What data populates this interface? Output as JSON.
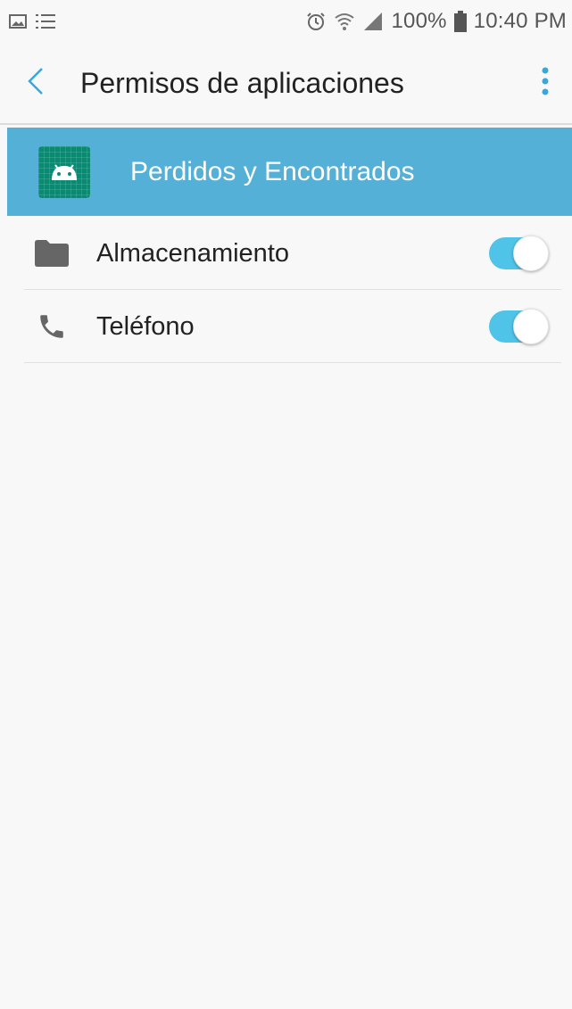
{
  "status_bar": {
    "left_icons": [
      "gallery-icon",
      "list-icon"
    ],
    "right_icons": [
      "alarm-icon",
      "wifi-icon",
      "signal-icon",
      "battery-icon"
    ],
    "battery": "100%",
    "time": "10:40 PM"
  },
  "app_bar": {
    "title": "Permisos de aplicaciones",
    "back_icon": "chevron-left-icon",
    "more_icon": "more-vertical-icon"
  },
  "app_header": {
    "app_name": "Perdidos y Encontrados",
    "icon": "android-icon",
    "background": "#54b0d6"
  },
  "permissions": [
    {
      "label": "Almacenamiento",
      "icon": "folder-icon",
      "enabled": true
    },
    {
      "label": "Teléfono",
      "icon": "phone-icon",
      "enabled": true
    }
  ],
  "colors": {
    "accent": "#4fc3e8",
    "back_arrow": "#3aa7d8",
    "header": "#54b0d6",
    "app_icon": "#0a8a72"
  }
}
